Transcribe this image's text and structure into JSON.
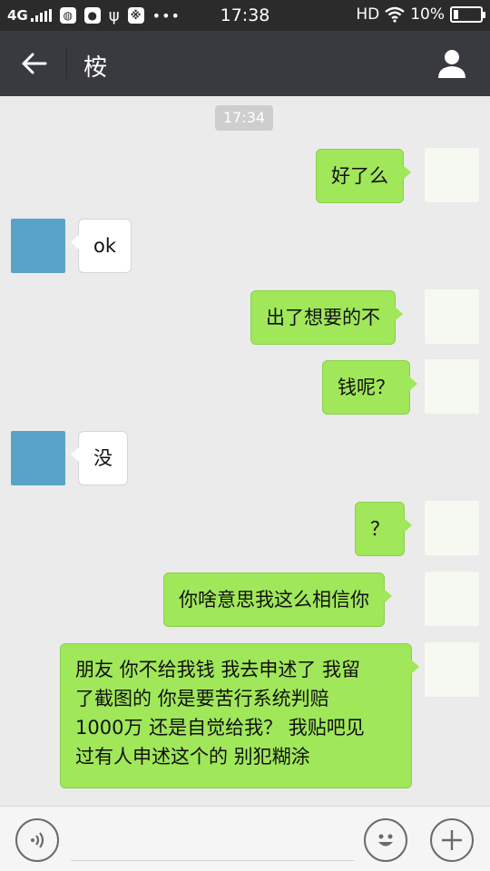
{
  "status_bar": {
    "network": "4G",
    "time": "17:38",
    "hd": "HD",
    "battery": "10%",
    "icons": [
      "signal-icon",
      "notification-app-icon",
      "chat-notification-icon",
      "usb-icon",
      "app-notification-icon",
      "more-dots-icon",
      "wifi-icon",
      "battery-icon"
    ]
  },
  "header": {
    "title": "桉",
    "icons": {
      "back": "back-arrow-icon",
      "profile": "person-icon"
    }
  },
  "chat": {
    "timestamp": "17:34",
    "messages": [
      {
        "from": "me",
        "text": "好了么"
      },
      {
        "from": "them",
        "text": "ok"
      },
      {
        "from": "me",
        "text": "出了想要的不"
      },
      {
        "from": "me",
        "text": "钱呢？"
      },
      {
        "from": "them",
        "text": "没"
      },
      {
        "from": "me",
        "text": "？"
      },
      {
        "from": "me",
        "text": "你啥意思我这么相信你"
      },
      {
        "from": "me",
        "text_lines": [
          "朋友 你不给我钱 我去申述了 我留",
          "了截图的 你是要苦行系统判赔",
          "1000万 还是自觉给我？ 我贴吧见",
          "过有人申述这个的 别犯糊涂"
        ]
      }
    ]
  },
  "input_bar": {
    "value": "",
    "placeholder": "",
    "icons": {
      "voice": "voice-icon",
      "emoji": "emoji-icon",
      "plus": "plus-icon"
    }
  },
  "colors": {
    "status_bar_bg": "#2b2b2b",
    "title_bar_bg": "#393a3f",
    "chat_bg": "#ebebeb",
    "my_bubble": "#a0e75a",
    "their_bubble": "#ffffff",
    "timestamp_bg": "#cecece"
  }
}
